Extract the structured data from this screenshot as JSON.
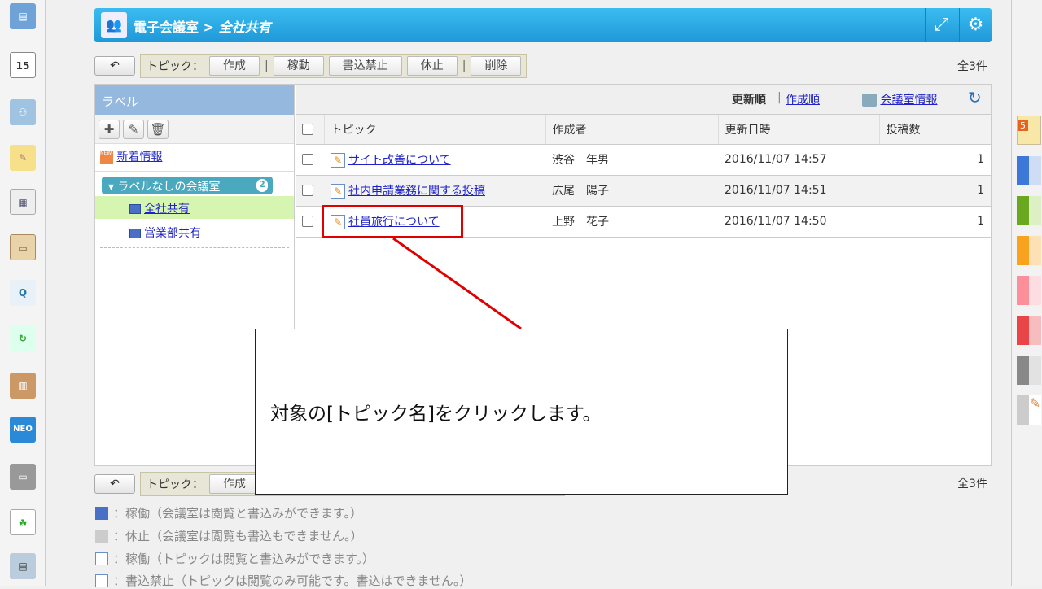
{
  "header": {
    "app": "電子会議室",
    "separator": ">",
    "room": "全社共有"
  },
  "toolbar": {
    "back": "↶",
    "topic_label": "トピック：",
    "create": "作成",
    "activate": "稼動",
    "write_prohibit": "書込禁止",
    "pause": "休止",
    "delete": "削除",
    "total": "全3件"
  },
  "labels": {
    "title": "ラベル",
    "whats_new": "新着情報",
    "group": "ラベルなしの会議室",
    "group_count": "2",
    "rooms": [
      "全社共有",
      "営業部共有"
    ]
  },
  "sort": {
    "updated": "更新順",
    "separator": "|",
    "created": "作成順",
    "room_info": "会議室情報"
  },
  "table": {
    "headers": [
      "トピック",
      "作成者",
      "更新日時",
      "投稿数"
    ],
    "rows": [
      {
        "topic": "サイト改善について",
        "author": "渋谷　年男",
        "updated": "2016/11/07 14:57",
        "posts": "1"
      },
      {
        "topic": "社内申請業務に関する投稿",
        "author": "広尾　陽子",
        "updated": "2016/11/07 14:51",
        "posts": "1"
      },
      {
        "topic": "社員旅行について",
        "author": "上野　花子",
        "updated": "2016/11/07 14:50",
        "posts": "1"
      }
    ]
  },
  "legend": [
    "：稼働（会議室は閲覧と書込みができます。）",
    "：休止（会議室は閲覧も書込もできません。）",
    "：稼働（トピックは閲覧と書込みができます。）",
    "：書込禁止（トピックは閲覧のみ可能です。書込はできません。）"
  ],
  "callout": "対象の[トピック名]をクリックします。",
  "sidebar": {
    "calendar_day": "15",
    "neo": "NEO",
    "memo_badge": "5"
  },
  "colors": {
    "header": "#1f98d8",
    "highlight": "#e00000",
    "selected_row": "#d6f5b0"
  }
}
